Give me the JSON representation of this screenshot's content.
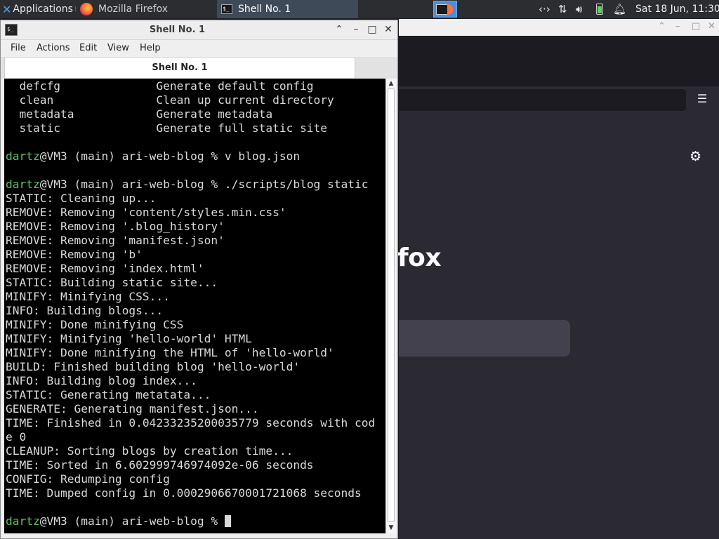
{
  "panel": {
    "applications_label": "Applications",
    "applications_suffix": "≡",
    "tasks": [
      {
        "label": "Mozilla Firefox",
        "icon": "firefox-icon"
      },
      {
        "label": "Shell No. 1",
        "icon": "terminal-icon"
      }
    ],
    "tray_icons": [
      "network-icon",
      "updown-arrows-icon",
      "volume-icon",
      "battery-icon",
      "bell-icon"
    ],
    "clock": "Sat 18 Jun, 11:30"
  },
  "firefox": {
    "brand_fragment": "fox",
    "menu_icon": "hamburger-menu-icon",
    "settings_icon": "gear-icon"
  },
  "terminal": {
    "title": "Shell No. 1",
    "menu": [
      "File",
      "Actions",
      "Edit",
      "View",
      "Help"
    ],
    "tab_label": "Shell No. 1",
    "lines": [
      {
        "text": "  defcfg              Generate default config"
      },
      {
        "text": "  clean               Clean up current directory"
      },
      {
        "text": "  metadata            Generate metadata"
      },
      {
        "text": "  static              Generate full static site"
      },
      {
        "text": ""
      },
      {
        "user": "dartz",
        "text": "@VM3 (main) ari-web-blog % v blog.json"
      },
      {
        "text": ""
      },
      {
        "user": "dartz",
        "text": "@VM3 (main) ari-web-blog % ./scripts/blog static"
      },
      {
        "text": "STATIC: Cleaning up..."
      },
      {
        "text": "REMOVE: Removing 'content/styles.min.css'"
      },
      {
        "text": "REMOVE: Removing '.blog_history'"
      },
      {
        "text": "REMOVE: Removing 'manifest.json'"
      },
      {
        "text": "REMOVE: Removing 'b'"
      },
      {
        "text": "REMOVE: Removing 'index.html'"
      },
      {
        "text": "STATIC: Building static site..."
      },
      {
        "text": "MINIFY: Minifying CSS..."
      },
      {
        "text": "INFO: Building blogs..."
      },
      {
        "text": "MINIFY: Done minifying CSS"
      },
      {
        "text": "MINIFY: Minifying 'hello-world' HTML"
      },
      {
        "text": "MINIFY: Done minifying the HTML of 'hello-world'"
      },
      {
        "text": "BUILD: Finished building blog 'hello-world'"
      },
      {
        "text": "INFO: Building blog index..."
      },
      {
        "text": "STATIC: Generating metatata..."
      },
      {
        "text": "GENERATE: Generating manifest.json..."
      },
      {
        "text": "TIME: Finished in 0.04233235200035779 seconds with cod"
      },
      {
        "text": "e 0"
      },
      {
        "text": "CLEANUP: Sorting blogs by creation time..."
      },
      {
        "text": "TIME: Sorted in 6.602999746974092e-06 seconds"
      },
      {
        "text": "CONFIG: Redumping config"
      },
      {
        "text": "TIME: Dumped config in 0.0002906670001721068 seconds"
      },
      {
        "text": ""
      },
      {
        "user": "dartz",
        "text": "@VM3 (main) ari-web-blog % ",
        "cursor": true
      }
    ]
  },
  "colors": {
    "prompt_user": "#5fc35f",
    "terminal_bg": "#000000",
    "terminal_fg": "#d9d9d9",
    "panel_bg": "#2b2d31",
    "active_task": "#3f4a58"
  }
}
